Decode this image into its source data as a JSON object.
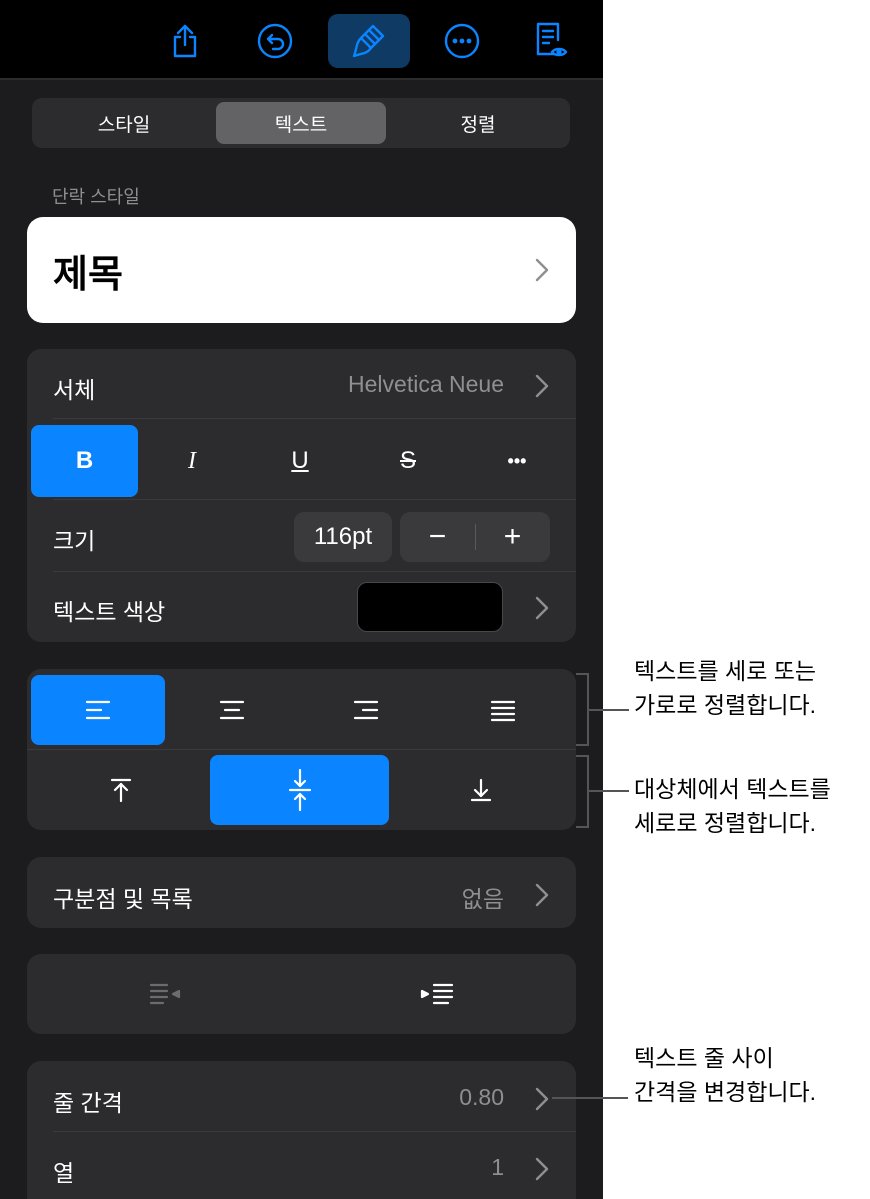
{
  "toolbar": {
    "icons": [
      "share-icon",
      "undo-icon",
      "format-brush-icon",
      "more-icon",
      "reader-view-icon"
    ],
    "active": "format-brush-icon"
  },
  "tabs": {
    "items": [
      "스타일",
      "텍스트",
      "정렬"
    ],
    "selected": "텍스트"
  },
  "paragraph_style": {
    "section_label": "단락 스타일",
    "value": "제목"
  },
  "font": {
    "label": "서체",
    "value": "Helvetica Neue",
    "format_buttons": [
      "B",
      "I",
      "U",
      "S",
      "•••"
    ],
    "active_format": "B",
    "size_label": "크기",
    "size_value": "116pt",
    "decrement": "−",
    "increment": "+",
    "color_label": "텍스트 색상",
    "color_value": "#000000"
  },
  "alignment": {
    "horizontal": [
      "align-left-icon",
      "align-center-icon",
      "align-right-icon",
      "justify-icon"
    ],
    "horizontal_active": "align-left-icon",
    "vertical": [
      "align-top-icon",
      "align-middle-icon",
      "align-bottom-icon"
    ],
    "vertical_active": "align-middle-icon"
  },
  "bullets": {
    "label": "구분점 및 목록",
    "value": "없음"
  },
  "indent": {
    "items": [
      "decrease-indent-icon",
      "increase-indent-icon"
    ]
  },
  "spacing": {
    "line_spacing_label": "줄 간격",
    "line_spacing_value": "0.80",
    "columns_label": "열",
    "columns_value": "1"
  },
  "callouts": {
    "horizontal_line1": "텍스트를 세로 또는",
    "horizontal_line2": "가로로 정렬합니다.",
    "vertical_line1": "대상체에서 텍스트를",
    "vertical_line2": "세로로 정렬합니다.",
    "spacing_line1": "텍스트 줄 사이",
    "spacing_line2": "간격을 변경합니다."
  },
  "colors": {
    "accent": "#0a84ff",
    "panel": "#1c1c1e",
    "group": "#2c2c2e",
    "secondary_text": "#8e8e93"
  }
}
